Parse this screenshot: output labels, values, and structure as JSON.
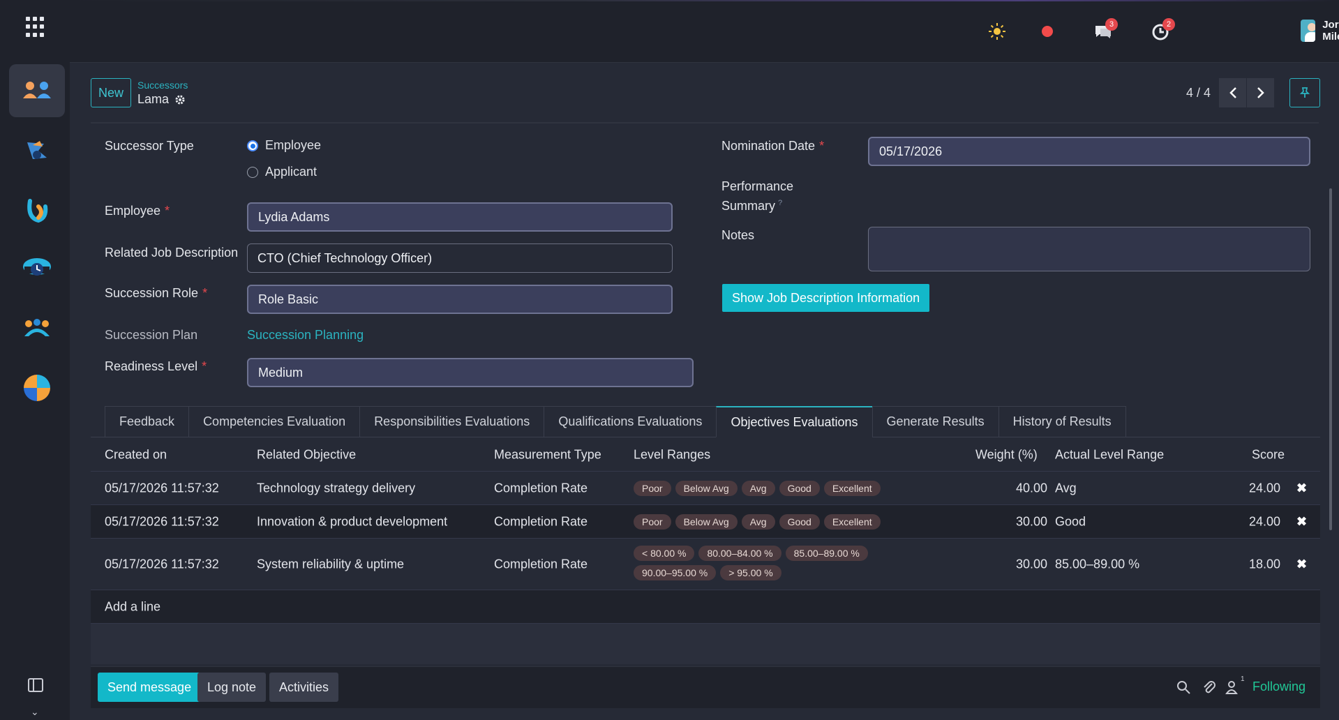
{
  "topbar": {
    "notification_chat_count": "3",
    "notification_activity_count": "2",
    "user_name": "Jordan Miles"
  },
  "sidebar": {
    "apps": [
      "people-app-icon",
      "bird-app-icon",
      "swirl-app-icon",
      "clock-app-icon",
      "team-app-icon",
      "pie-app-icon"
    ]
  },
  "control": {
    "new_label": "New",
    "breadcrumb_parent": "Successors",
    "breadcrumb_current": "Lama",
    "pager_value": "4 / 4"
  },
  "form": {
    "successor_type_label": "Successor Type",
    "successor_type_options": [
      "Employee",
      "Applicant"
    ],
    "successor_type_selected": "Employee",
    "employee_label": "Employee",
    "employee_value": "Lydia Adams",
    "related_job_label": "Related Job Description",
    "related_job_value": "CTO (Chief Technology Officer)",
    "succession_role_label": "Succession Role",
    "succession_role_value": "Role Basic",
    "succession_plan_label": "Succession Plan",
    "succession_plan_value": "Succession Planning",
    "readiness_label": "Readiness Level",
    "readiness_value": "Medium",
    "nomination_label": "Nomination Date",
    "nomination_value": "05/17/2026",
    "perf_label_1": "Performance",
    "perf_label_2": "Summary",
    "notes_label": "Notes",
    "show_job_btn": "Show Job Description Information"
  },
  "tabs": [
    "Feedback",
    "Competencies Evaluation",
    "Responsibilities Evaluations",
    "Qualifications Evaluations",
    "Objectives Evaluations",
    "Generate Results",
    "History of Results"
  ],
  "table": {
    "headers": [
      "Created on",
      "Related Objective",
      "Measurement Type",
      "Level Ranges",
      "Weight (%)",
      "Actual Level Range",
      "Score"
    ],
    "rows": [
      {
        "created": "05/17/2026 11:57:32",
        "objective": "Technology strategy delivery",
        "type": "Completion Rate",
        "ranges": [
          "Poor",
          "Below Avg",
          "Avg",
          "Good",
          "Excellent"
        ],
        "weight": "40.00",
        "actual": "Avg",
        "score": "24.00"
      },
      {
        "created": "05/17/2026 11:57:32",
        "objective": "Innovation & product development",
        "type": "Completion Rate",
        "ranges": [
          "Poor",
          "Below Avg",
          "Avg",
          "Good",
          "Excellent"
        ],
        "weight": "30.00",
        "actual": "Good",
        "score": "24.00"
      },
      {
        "created": "05/17/2026 11:57:32",
        "objective": "System reliability & uptime",
        "type": "Completion Rate",
        "ranges": [
          "< 80.00 %",
          "80.00–84.00 %",
          "85.00–89.00 %",
          "90.00–95.00 %",
          "> 95.00 %"
        ],
        "weight": "30.00",
        "actual": "85.00–89.00 %",
        "score": "18.00"
      }
    ],
    "add_line": "Add a line",
    "delete_glyph": "✖"
  },
  "chatter": {
    "send_message": "Send message",
    "log_note": "Log note",
    "activities": "Activities",
    "follower_count": "1",
    "following": "Following"
  }
}
